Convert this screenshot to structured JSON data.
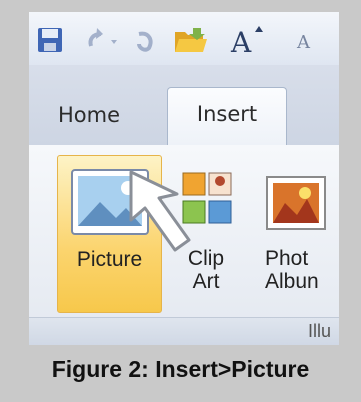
{
  "tabs": [
    {
      "label": "Home"
    },
    {
      "label": "Insert",
      "active": true
    }
  ],
  "quick_access_icons": [
    "save-icon",
    "undo-icon",
    "redo-icon",
    "open-folder-icon",
    "grow-font-icon"
  ],
  "ribbon": {
    "buttons": {
      "picture": {
        "label": "Picture",
        "icon": "picture-icon",
        "highlighted": true
      },
      "clip_art": {
        "line1": "Clip",
        "line2": "Art",
        "icon": "clip-art-icon"
      },
      "photo_album": {
        "line1": "Phot",
        "line2": "Albun",
        "icon": "photo-album-icon"
      }
    },
    "group_label": "Illu"
  },
  "caption": "Figure 2: Insert>Picture",
  "colors": {
    "highlight": "#fbd46e",
    "frame_bg": "#c9c9c9"
  }
}
